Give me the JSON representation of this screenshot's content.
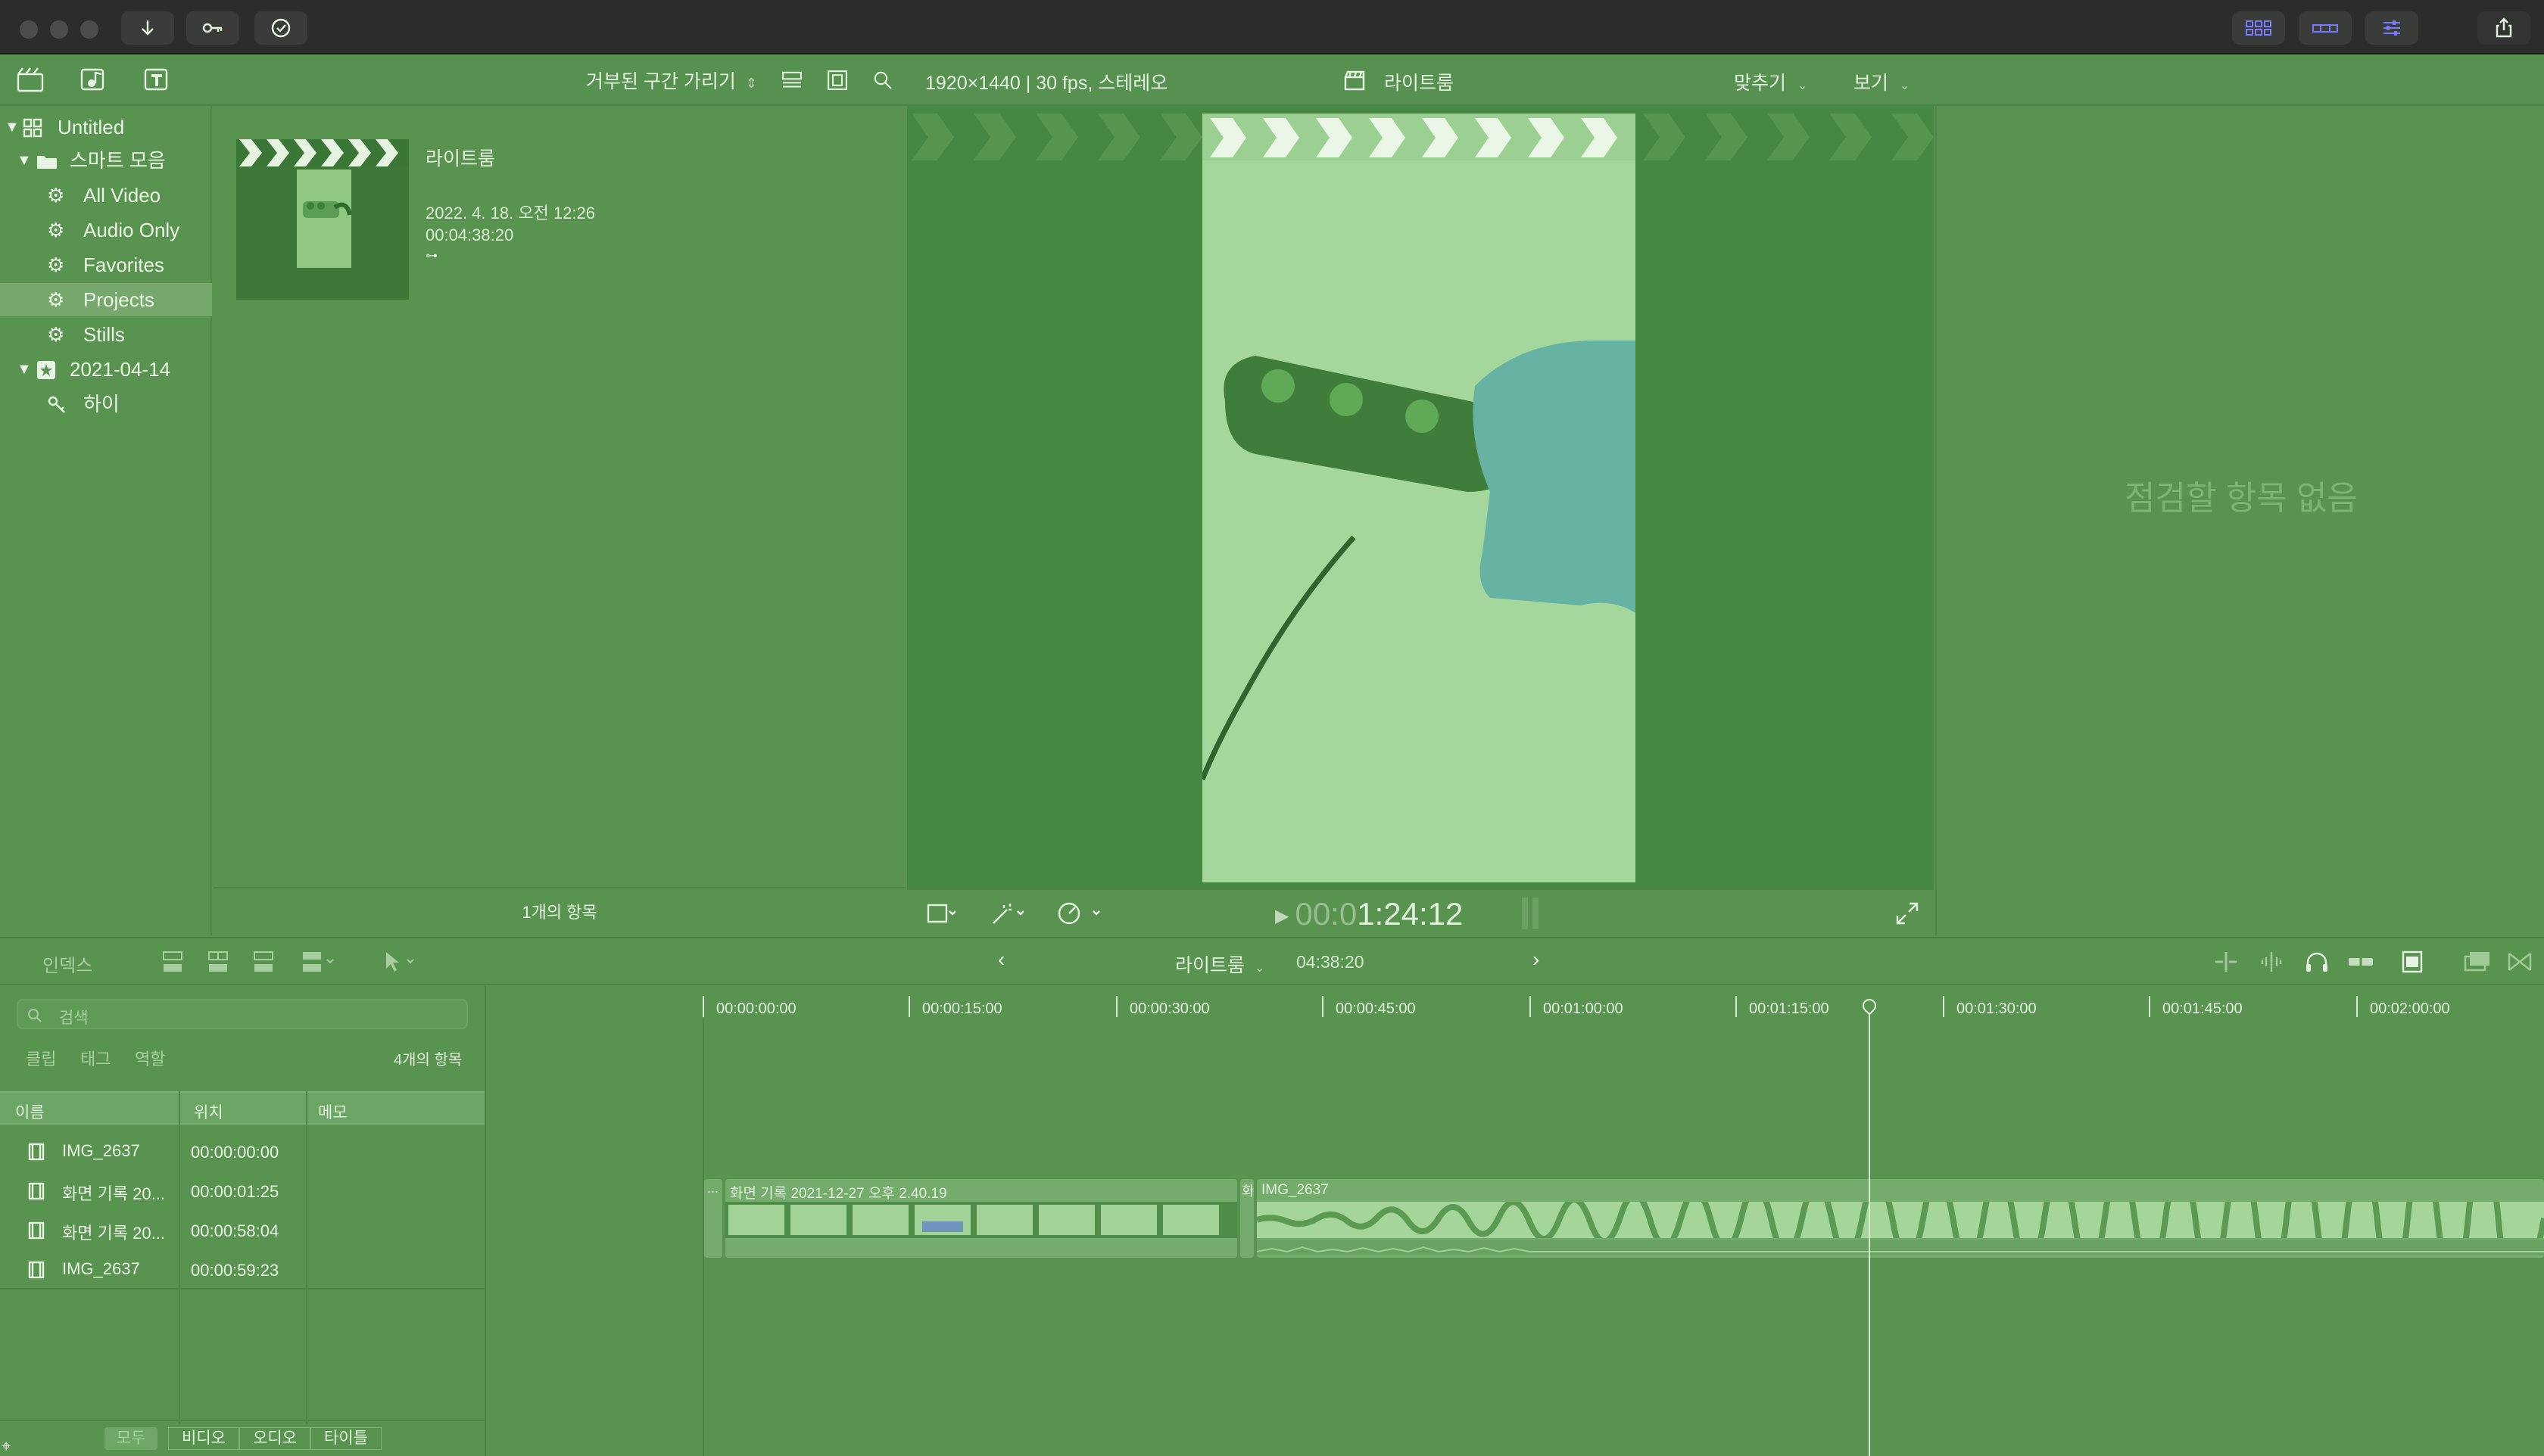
{
  "toolbar": {
    "filter_label": "거부된 구간 가리기",
    "format_info": "1920×1440 | 30 fps, 스테레오",
    "viewer_title": "라이트룸",
    "fit_label": "맞추기",
    "view_label": "보기"
  },
  "sidebar": {
    "items": [
      {
        "label": "Untitled"
      },
      {
        "label": "스마트 모음"
      },
      {
        "label": "All Video"
      },
      {
        "label": "Audio Only"
      },
      {
        "label": "Favorites"
      },
      {
        "label": "Projects"
      },
      {
        "label": "Stills"
      },
      {
        "label": "2021-04-14"
      },
      {
        "label": "하이"
      }
    ]
  },
  "browser": {
    "clip": {
      "title": "라이트룸",
      "date": "2022. 4. 18. 오전 12:26",
      "duration": "00:04:38:20"
    },
    "footer": "1개의 항목"
  },
  "viewer": {
    "timecode_dim": "00:0",
    "timecode": "1:24:12"
  },
  "inspector": {
    "empty_text": "점검할 항목 없음"
  },
  "timeline_header": {
    "index_label": "인덱스",
    "project_name": "라이트룸",
    "project_duration": "04:38:20"
  },
  "index": {
    "search_placeholder": "검색",
    "tabs": [
      "클립",
      "태그",
      "역할"
    ],
    "count": "4개의 항목",
    "columns": [
      "이름",
      "위치",
      "메모"
    ],
    "rows": [
      {
        "name": "IMG_2637",
        "position": "00:00:00:00"
      },
      {
        "name": "화면 기록 20...",
        "position": "00:00:01:25"
      },
      {
        "name": "화면 기록 20...",
        "position": "00:00:58:04"
      },
      {
        "name": "IMG_2637",
        "position": "00:00:59:23"
      }
    ],
    "filters": [
      "모두",
      "비디오",
      "오디오",
      "타이틀"
    ]
  },
  "timeline": {
    "ruler": [
      "00:00:00:00",
      "00:00:15:00",
      "00:00:30:00",
      "00:00:45:00",
      "00:01:00:00",
      "00:01:15:00",
      "00:01:30:00",
      "00:01:45:00",
      "00:02:00:00"
    ],
    "clips": [
      {
        "label": "..."
      },
      {
        "label": "화면 기록 2021-12-27 오후 2.40.19"
      },
      {
        "label": "화"
      },
      {
        "label": "IMG_2637"
      }
    ]
  },
  "colors": {
    "background": "#58934f",
    "titlebar": "#2b2d2b",
    "viewer_bg": "#468741",
    "accent": "#6b6bff"
  }
}
